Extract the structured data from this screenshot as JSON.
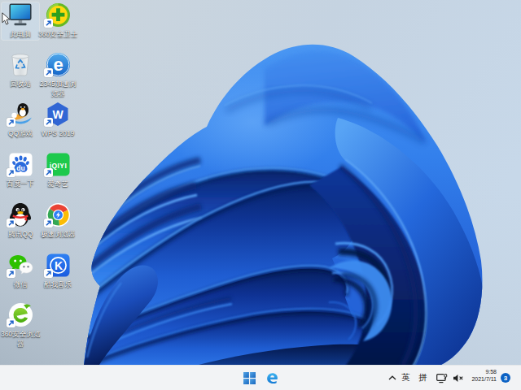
{
  "desktop": {
    "wallpaper": "windows-11-bloom-blue",
    "cursor": "arrow-cursor",
    "icons": [
      {
        "name": "this-pc",
        "label": "此电脑",
        "selected": true,
        "shortcut": false,
        "icon": "monitor-icon"
      },
      {
        "name": "360-safety-guard",
        "label": "360安全卫士",
        "selected": false,
        "shortcut": true,
        "icon": "green-shield-plus-icon"
      },
      {
        "name": "recycle-bin",
        "label": "回收站",
        "selected": false,
        "shortcut": false,
        "icon": "trash-can-recycle-icon"
      },
      {
        "name": "2345-browser",
        "label": "2345加速浏\n览器",
        "selected": false,
        "shortcut": true,
        "icon": "blue-e-globe-icon"
      },
      {
        "name": "qq-games",
        "label": "QQ游戏",
        "selected": false,
        "shortcut": true,
        "icon": "surfing-penguin-icon"
      },
      {
        "name": "wps-2019",
        "label": "WPS 2019",
        "selected": false,
        "shortcut": true,
        "icon": "wps-hexagon-w-icon"
      },
      {
        "name": "baidu",
        "label": "百度一下",
        "selected": false,
        "shortcut": true,
        "icon": "baidu-paw-icon"
      },
      {
        "name": "iqiyi",
        "label": "爱奇艺",
        "selected": false,
        "shortcut": true,
        "icon": "iqiyi-green-icon"
      },
      {
        "name": "tencent-qq",
        "label": "腾讯QQ",
        "selected": false,
        "shortcut": true,
        "icon": "qq-penguin-icon"
      },
      {
        "name": "speed-browser",
        "label": "极速浏览器",
        "selected": false,
        "shortcut": true,
        "icon": "chrome-lightning-icon"
      },
      {
        "name": "wechat",
        "label": "微信",
        "selected": false,
        "shortcut": true,
        "icon": "wechat-bubbles-icon"
      },
      {
        "name": "kuwo-music",
        "label": "酷我音乐",
        "selected": false,
        "shortcut": true,
        "icon": "kuwo-k-circle-icon"
      },
      {
        "name": "360-browser",
        "label": "360安全浏览\n器",
        "selected": false,
        "shortcut": true,
        "icon": "green-e-swirl-icon"
      }
    ]
  },
  "taskbar": {
    "alignment": "center",
    "items": [
      {
        "name": "start-button",
        "icon": "windows-logo-icon"
      },
      {
        "name": "edge-browser-button",
        "icon": "edge-e-icon"
      }
    ],
    "tray": {
      "chevron_icon": "chevron-up-icon",
      "ime_english": "英",
      "ime_pinyin": "拼",
      "network_icon": "ethernet-network-icon",
      "volume_icon": "volume-muted-icon",
      "time": "9:58",
      "date": "2021/7/11",
      "notification_count": "3"
    }
  },
  "colors": {
    "taskbar_bg": "#f2f3f5",
    "accent_badge": "#0b61c4",
    "bloom_bright": "#3f8cf0",
    "bloom_mid": "#1f5dd2",
    "bloom_dark": "#0a2d7f",
    "bloom_deep": "#041345",
    "sky_top_left": "#ccd5db",
    "sky_right": "#c7d8e9"
  }
}
